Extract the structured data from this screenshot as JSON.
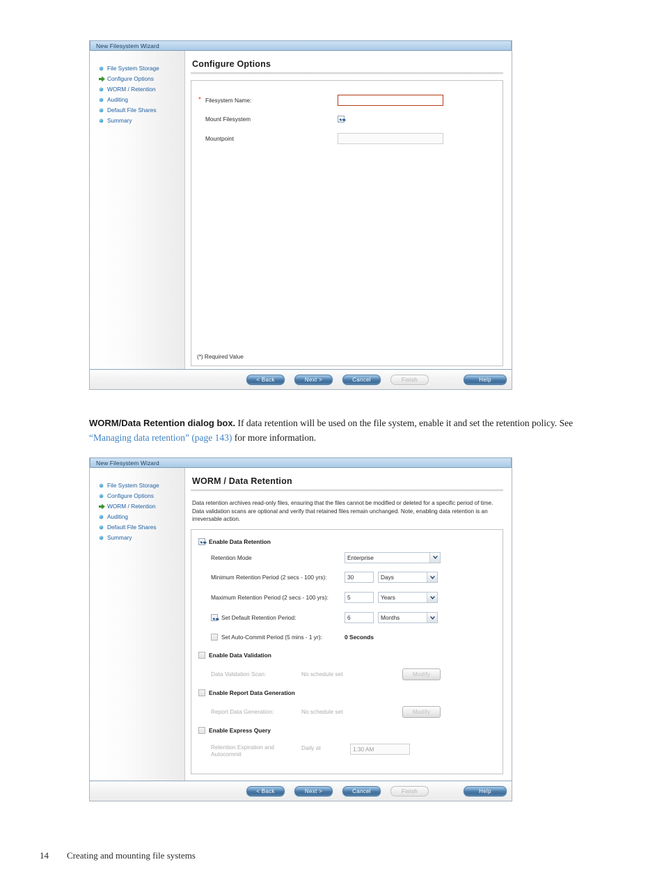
{
  "colors": {
    "nav_link": "#1f5fa0",
    "active_arrow": "#3b9a2e",
    "required_border": "#b53a16",
    "button_blue": "#4b7ba8",
    "link_blue": "#3f83c4"
  },
  "dialog1": {
    "titlebar": "New Filesystem Wizard",
    "nav": [
      {
        "label": "File System Storage",
        "marker": "bullet-icon",
        "active": false
      },
      {
        "label": "Configure Options",
        "marker": "arrow-right-icon",
        "active": true
      },
      {
        "label": "WORM / Retention",
        "marker": "bullet-icon",
        "active": false
      },
      {
        "label": "Auditing",
        "marker": "bullet-icon",
        "active": false
      },
      {
        "label": "Default File Shares",
        "marker": "bullet-icon",
        "active": false
      },
      {
        "label": "Summary",
        "marker": "bullet-icon",
        "active": false
      }
    ],
    "title": "Configure Options",
    "fields": {
      "filesystem_name_label": "Filesystem Name:",
      "filesystem_name_star": "*",
      "filesystem_name_value": "",
      "mount_filesystem_label": "Mount Filesystem",
      "mount_filesystem_checked": "checked",
      "mountpoint_label": "Mountpoint",
      "mountpoint_value": ""
    },
    "required_note": "(*) Required Value",
    "buttons": {
      "back": "< Back",
      "next": "Next >",
      "cancel": "Cancel",
      "finish": "Finish",
      "help": "Help"
    }
  },
  "prose": {
    "lead_bold": "WORM/Data Retention dialog box.",
    "text_1": " If data retention will be used on the file system, enable it and set the retention policy. See ",
    "link": "“Managing data retention” (page 143)",
    "text_2": " for more information."
  },
  "dialog2": {
    "titlebar": "New Filesystem Wizard",
    "nav": [
      {
        "label": "File System Storage",
        "marker": "bullet-icon",
        "active": false
      },
      {
        "label": "Configure Options",
        "marker": "bullet-icon",
        "active": false
      },
      {
        "label": "WORM / Retention",
        "marker": "arrow-right-icon",
        "active": true
      },
      {
        "label": "Auditing",
        "marker": "bullet-icon",
        "active": false
      },
      {
        "label": "Default File Shares",
        "marker": "bullet-icon",
        "active": false
      },
      {
        "label": "Summary",
        "marker": "bullet-icon",
        "active": false
      }
    ],
    "title": "WORM / Data Retention",
    "description": "Data retention archives read-only files, ensuring that the files cannot be modified or deleted for a specific period of time. Data validation scans are optional and verify that retained files remain unchanged. Note, enabling data retention is an irreversable action.",
    "form": {
      "enable_data_retention": "Enable Data Retention",
      "enable_data_retention_checked": "checked",
      "retention_mode_label": "Retention Mode",
      "retention_mode_value": "Enterprise",
      "min_period_label": "Minimum Retention Period (2 secs - 100 yrs):",
      "min_period_value": "30",
      "min_period_unit": "Days",
      "max_period_label": "Maximum Retention Period (2 secs - 100 yrs):",
      "max_period_value": "5",
      "max_period_unit": "Years",
      "default_period_label": "Set Default Retention Period:",
      "default_period_checked": "checked",
      "default_period_value": "6",
      "default_period_unit": "Months",
      "autocommit_label": "Set Auto-Commit Period (5 mins - 1 yr):",
      "autocommit_checked": "unchecked",
      "autocommit_value": "0 Seconds",
      "enable_data_validation": "Enable Data Validation",
      "enable_data_validation_checked": "unchecked",
      "data_validation_scan_label": "Data Validation Scan:",
      "data_validation_scan_value": "No schedule set",
      "data_validation_modify": "Modify",
      "enable_report_data": "Enable Report Data Generation",
      "enable_report_data_checked": "unchecked",
      "report_data_label": "Report Data Generation:",
      "report_data_value": "No schedule set",
      "report_data_modify": "Modify",
      "enable_express_query": "Enable Express Query",
      "enable_express_query_checked": "unchecked",
      "retention_expiration_label_1": "Retention Expiration and",
      "retention_expiration_label_2": "Autocommit",
      "daily_at_label": "Daily at",
      "daily_at_value": "1:30 AM"
    },
    "buttons": {
      "back": "< Back",
      "next": "Next >",
      "cancel": "Cancel",
      "finish": "Finish",
      "help": "Help"
    }
  },
  "footer": {
    "page_number": "14",
    "chapter": "Creating and mounting file systems"
  }
}
